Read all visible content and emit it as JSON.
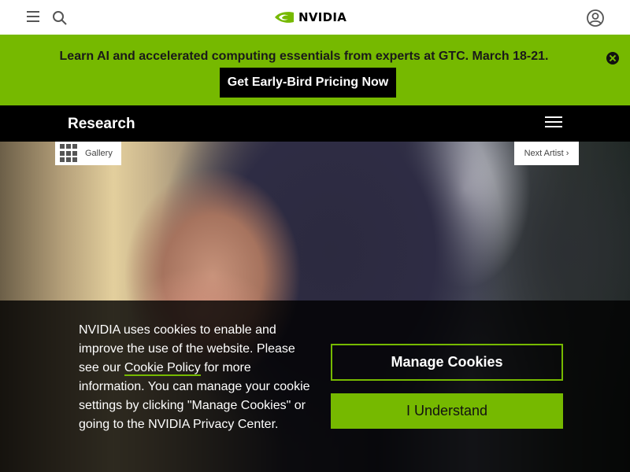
{
  "header": {
    "logo_text": "NVIDIA",
    "brand_color": "#76b900",
    "icons": [
      "menu-icon",
      "search-icon",
      "account-icon"
    ]
  },
  "promo": {
    "message": "Learn AI and accelerated computing essentials from experts at GTC. March 18-21.",
    "cta_label": "Get Early-Bird Pricing Now",
    "background_color": "#76b900"
  },
  "section_nav": {
    "title": "Research"
  },
  "hero": {
    "gallery_label": "Gallery",
    "next_label": "Next Artist ›"
  },
  "cookie_banner": {
    "text_before_link": "NVIDIA uses cookies to enable and improve the use of the website. Please see our ",
    "link_text": "Cookie Policy",
    "text_after_link": " for more information. You can manage your cookie settings by clicking \"Manage Cookies\" or going to the NVIDIA Privacy Center.",
    "manage_label": "Manage Cookies",
    "accept_label": "I Understand"
  }
}
